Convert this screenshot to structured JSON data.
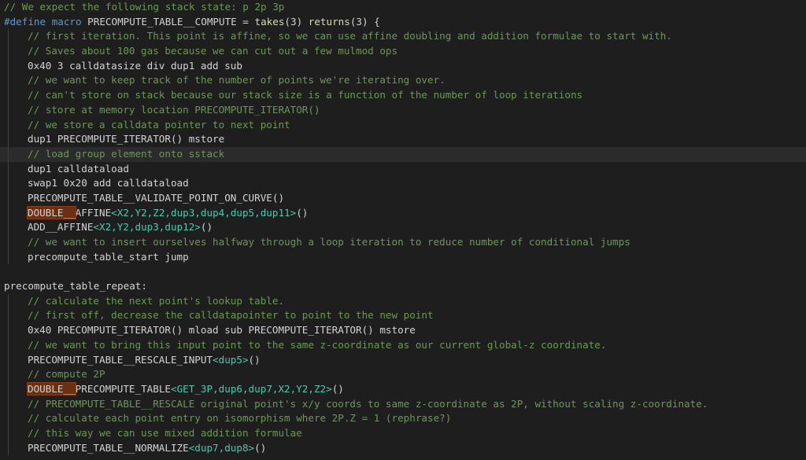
{
  "colors": {
    "background": "#1e1e1e",
    "comment": "#6a9955",
    "keyword": "#569cd6",
    "function": "#dcdcaa",
    "text": "#d4d4d4",
    "generic": "#4ec9b0",
    "highlight": "#6b2f12"
  },
  "lines": [
    {
      "t": "// We expect the following stack state: p 2p 3p"
    },
    {
      "kw": "#define",
      "a": " ",
      "kw2": "macro",
      "b": " PRECOMPUTE_TABLE__COMPUTE = ",
      "fn1": "takes",
      "c": "(3) ",
      "fn2": "returns",
      "d": "(3) {"
    },
    {
      "t": "// first iteration. This point is affine, so we can use affine doubling and addition formulae to start with."
    },
    {
      "t": "// Saves about 100 gas because we can cut out a few mulmod ops"
    },
    {
      "t": "0x40 3 calldatasize div dup1 add sub"
    },
    {
      "t": "// we want to keep track of the number of points we're iterating over."
    },
    {
      "t": "// can't store on stack because our stack size is a function of the number of loop iterations"
    },
    {
      "t": "// store at memory location PRECOMPUTE_ITERATOR()"
    },
    {
      "t": "// we store a calldata pointer to next point"
    },
    {
      "t": "dup1 PRECOMPUTE_ITERATOR() mstore"
    },
    {
      "t": "// load group element onto sstack"
    },
    {
      "t": "dup1 calldataload"
    },
    {
      "t": "swap1 0x20 add calldataload"
    },
    {
      "t": "PRECOMPUTE_TABLE__VALIDATE_POINT_ON_CURVE()"
    },
    {
      "h": "DOUBLE__",
      "a": "AFFINE",
      "g": "<X2,Y2,Z2,dup3,dup4,dup5,dup11>",
      "b": "()"
    },
    {
      "a": "ADD__AFFINE",
      "g": "<X2,Y2,dup3,dup12>",
      "b": "()"
    },
    {
      "t": "// we want to insert ourselves halfway through a loop iteration to reduce number of conditional jumps"
    },
    {
      "t": "precompute_table_start jump"
    },
    {
      "t": ""
    },
    {
      "t": "precompute_table_repeat:"
    },
    {
      "t": "// calculate the next point's lookup table."
    },
    {
      "t": "// first off, decrease the calldatapointer to point to the new point"
    },
    {
      "t": "0x40 PRECOMPUTE_ITERATOR() mload sub PRECOMPUTE_ITERATOR() mstore"
    },
    {
      "t": "// we want to bring this input point to the same z-coordinate as our current global-z coordinate."
    },
    {
      "a": "PRECOMPUTE_TABLE__RESCALE_INPUT",
      "g": "<dup5>",
      "b": "()"
    },
    {
      "t": "// compute 2P"
    },
    {
      "h": "DOUBLE__",
      "a": "PRECOMPUTE_TABLE",
      "g": "<GET_3P,dup6,dup7,X2,Y2,Z2>",
      "b": "()"
    },
    {
      "t": "// PRECOMPUTE_TABLE__RESCALE original point's x/y coords to same z-coordinate as 2P, without scaling z-coordinate."
    },
    {
      "t": "// calculate each point entry on isomorphism where 2P.Z = 1 (rephrase?)"
    },
    {
      "t": "// this way we can use mixed addition formulae"
    },
    {
      "a": "PRECOMPUTE_TABLE__NORMALIZE",
      "g": "<dup7,dup8>",
      "b": "()"
    }
  ]
}
